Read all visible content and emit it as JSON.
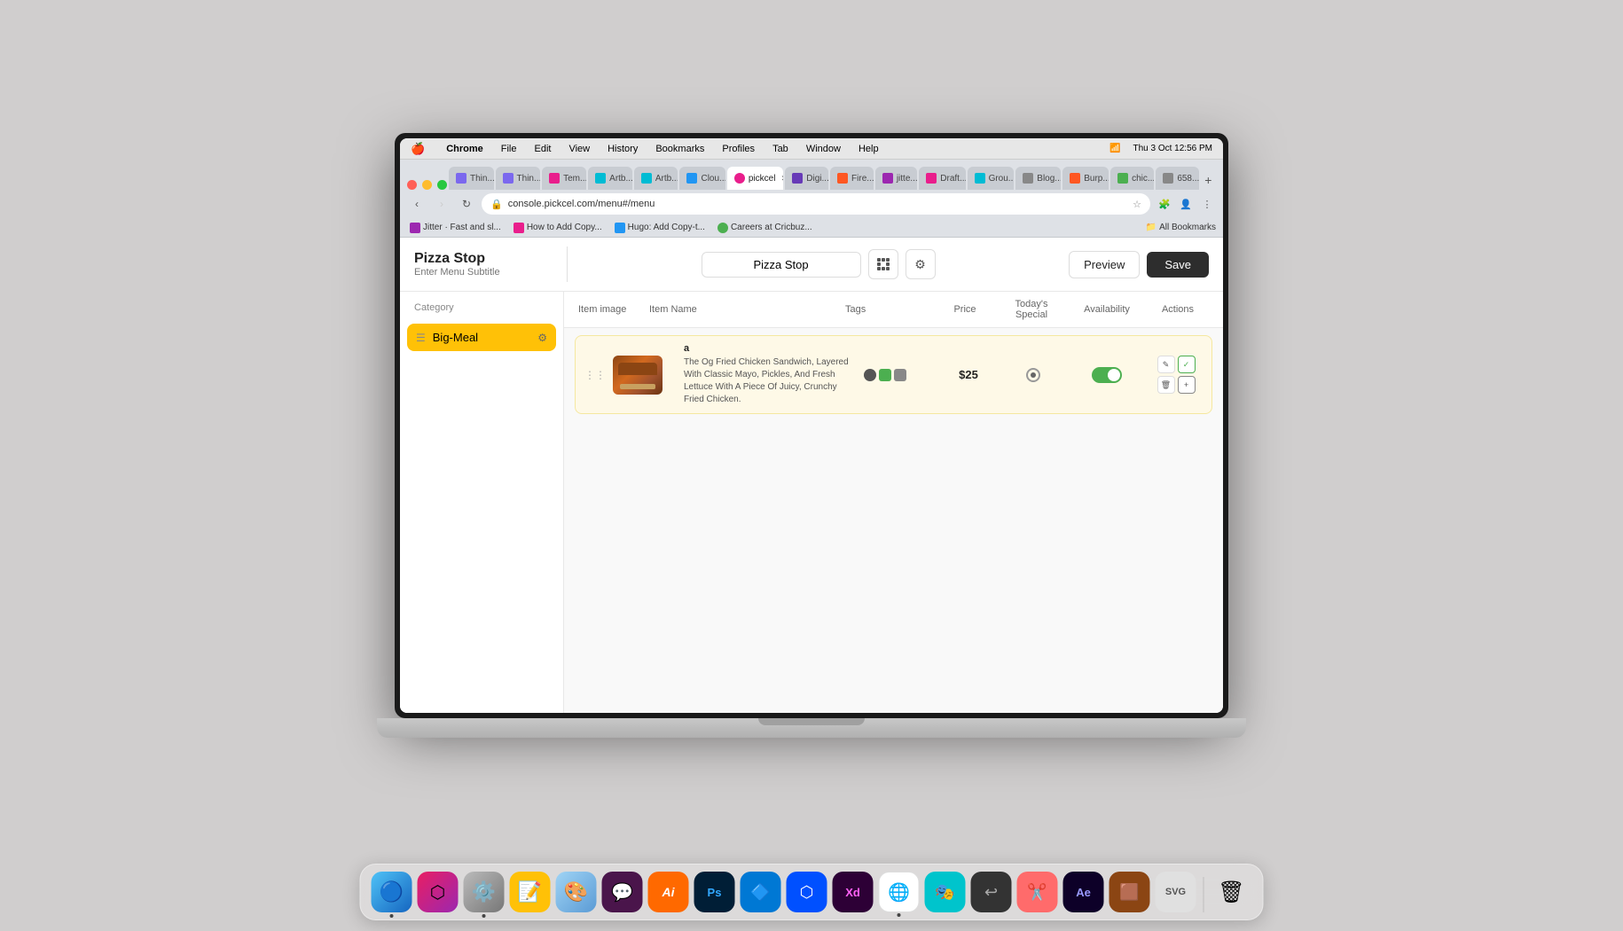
{
  "macos": {
    "apple": "🍎",
    "menu_items": [
      "Chrome",
      "File",
      "Edit",
      "View",
      "History",
      "Bookmarks",
      "Profiles",
      "Tab",
      "Window",
      "Help"
    ],
    "time": "Thu 3 Oct  12:56 PM"
  },
  "browser": {
    "tabs": [
      {
        "label": "Thin...",
        "color": "#7B68EE",
        "active": false
      },
      {
        "label": "Thin...",
        "color": "#7B68EE",
        "active": false
      },
      {
        "label": "Temp...",
        "color": "#e91e8c",
        "active": false
      },
      {
        "label": "Artb...",
        "color": "#00bcd4",
        "active": false
      },
      {
        "label": "Artb...",
        "color": "#00bcd4",
        "active": false
      },
      {
        "label": "Clou...",
        "color": "#2196F3",
        "active": false
      },
      {
        "label": "pickcel",
        "color": "#e91e8c",
        "active": true
      },
      {
        "label": "Digit...",
        "color": "#673AB7",
        "active": false
      },
      {
        "label": "Fire...",
        "color": "#FF5722",
        "active": false
      },
      {
        "label": "jitter...",
        "color": "#9c27b0",
        "active": false
      },
      {
        "label": "Draft...",
        "color": "#e91e8c",
        "active": false
      },
      {
        "label": "Grou...",
        "color": "#00bcd4",
        "active": false
      },
      {
        "label": "Blog...",
        "color": "#888",
        "active": false
      },
      {
        "label": "Burp...",
        "color": "#FF5722",
        "active": false
      },
      {
        "label": "chic...",
        "color": "#4CAF50",
        "active": false
      },
      {
        "label": "6583",
        "color": "#888",
        "active": false
      }
    ],
    "url": "console.pickcel.com/menu#/menu",
    "bookmarks": [
      {
        "label": "Jitter · Fast and sl...",
        "icon": "#9c27b0"
      },
      {
        "label": "How to Add Copy...",
        "icon": "#e91e8c"
      },
      {
        "label": "Hugo: Add Copy-t...",
        "icon": "#2196F3"
      },
      {
        "label": "Careers at Cricbuz...",
        "icon": "#4CAF50"
      }
    ],
    "bookmarks_folder": "All Bookmarks"
  },
  "app": {
    "title": "Pizza Stop",
    "subtitle_placeholder": "Enter Menu Subtitle",
    "menu_name": "Pizza Stop",
    "buttons": {
      "preview": "Preview",
      "save": "Save"
    }
  },
  "sidebar": {
    "header": "Category",
    "categories": [
      {
        "id": "big-meal",
        "label": "Big-Meal",
        "active": true
      }
    ]
  },
  "table": {
    "headers": {
      "image": "Item image",
      "name": "Item Name",
      "tags": "Tags",
      "price": "Price",
      "special": "Today's Special",
      "availability": "Availability",
      "actions": "Actions"
    },
    "items": [
      {
        "name": "a",
        "description": "The Og Fried Chicken Sandwich, Layered With Classic Mayo, Pickles, And Fresh Lettuce With A Piece Of Juicy, Crunchy Fried Chicken.",
        "price": "$25",
        "availability": true,
        "tags": [
          "#4CAF50",
          "#2196F3",
          "#888"
        ]
      }
    ]
  },
  "dock": {
    "apps": [
      {
        "name": "finder",
        "label": "Finder",
        "emoji": "🔵",
        "bg": "#2196F3",
        "dot": true
      },
      {
        "name": "launchpad",
        "label": "Launchpad",
        "emoji": "🟣",
        "bg": "#9c27b0",
        "dot": false
      },
      {
        "name": "system-prefs",
        "label": "System Preferences",
        "emoji": "⚙️",
        "bg": "#888",
        "dot": true
      },
      {
        "name": "stickies",
        "label": "Stickies",
        "emoji": "📝",
        "bg": "#FFC107",
        "dot": false
      },
      {
        "name": "freeform",
        "label": "Freeform",
        "emoji": "🎨",
        "bg": "#7CB9E8",
        "dot": false
      },
      {
        "name": "slack",
        "label": "Slack",
        "emoji": "💬",
        "bg": "#611f69",
        "dot": false
      },
      {
        "name": "illustrator",
        "label": "Illustrator",
        "emoji": "Ai",
        "bg": "#FF6900",
        "dot": false
      },
      {
        "name": "photoshop",
        "label": "Photoshop",
        "emoji": "Ps",
        "bg": "#31A8FF",
        "dot": false
      },
      {
        "name": "vscode",
        "label": "VS Code",
        "emoji": "🔷",
        "bg": "#0078d4",
        "dot": false
      },
      {
        "name": "framer",
        "label": "Framer",
        "emoji": "🔲",
        "bg": "#0050FF",
        "dot": false
      },
      {
        "name": "xd",
        "label": "Adobe XD",
        "emoji": "Xd",
        "bg": "#FF61F6",
        "dot": false
      },
      {
        "name": "chrome",
        "label": "Chrome",
        "emoji": "🌐",
        "bg": "#4285F4",
        "dot": true
      },
      {
        "name": "canva",
        "label": "Canva",
        "emoji": "🎭",
        "bg": "#00C4CC",
        "dot": false
      },
      {
        "name": "mystery",
        "label": "App",
        "emoji": "↩",
        "bg": "#333",
        "dot": false
      },
      {
        "name": "capcut",
        "label": "CapCut",
        "emoji": "✂️",
        "bg": "#ff6b6b",
        "dot": false
      },
      {
        "name": "aftereffects",
        "label": "After Effects",
        "emoji": "Ae",
        "bg": "#9999FF",
        "dot": false
      },
      {
        "name": "app2",
        "label": "App",
        "emoji": "🟫",
        "bg": "#8B4513",
        "dot": false
      },
      {
        "name": "svg",
        "label": "SVG App",
        "emoji": "▶",
        "bg": "#aaa",
        "dot": false
      },
      {
        "name": "trash",
        "label": "Trash",
        "emoji": "🗑",
        "bg": "transparent",
        "dot": false
      }
    ]
  }
}
